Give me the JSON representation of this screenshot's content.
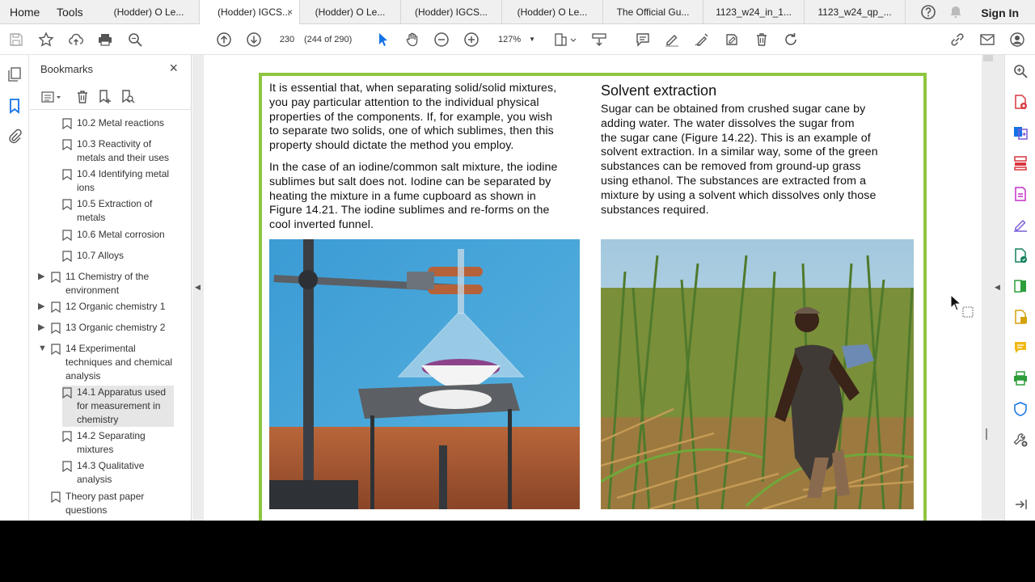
{
  "menu": {
    "home": "Home",
    "tools": "Tools"
  },
  "tabs": [
    {
      "label": "(Hodder) O Le..."
    },
    {
      "label": "(Hodder) IGCS...",
      "close": "×"
    },
    {
      "label": "(Hodder) O Le..."
    },
    {
      "label": "(Hodder) IGCS..."
    },
    {
      "label": "(Hodder) O Le..."
    },
    {
      "label": "The Official Gu..."
    },
    {
      "label": "1123_w24_in_1..."
    },
    {
      "label": "1123_w24_qp_..."
    }
  ],
  "account": {
    "sign_in": "Sign In"
  },
  "toolbar": {
    "page_number": "230",
    "page_count": "(244 of 290)",
    "zoom": "127%"
  },
  "bookmarks": {
    "title": "Bookmarks",
    "close": "×",
    "items": [
      {
        "label": "10.2 Metal reactions"
      },
      {
        "label": "10.3 Reactivity of",
        "label2": "metals and their uses"
      },
      {
        "label": "10.4 Identifying metal",
        "label2": "ions"
      },
      {
        "label": "10.5 Extraction of",
        "label2": "metals"
      },
      {
        "label": "10.6 Metal corrosion"
      },
      {
        "label": "10.7 Alloys"
      },
      {
        "label": "11 Chemistry of the",
        "label2": "environment"
      },
      {
        "label": "12 Organic chemistry 1"
      },
      {
        "label": "13 Organic chemistry 2"
      },
      {
        "label": "14 Experimental",
        "label2": "techniques and chemical",
        "label3": "analysis"
      },
      {
        "label": "14.1 Apparatus used",
        "label2": "for measurement in",
        "label3": "chemistry"
      },
      {
        "label": "14.2 Separating",
        "label2": "mixtures"
      },
      {
        "label": "14.3 Qualitative",
        "label2": "analysis"
      },
      {
        "label": "Theory past paper",
        "label2": "questions"
      }
    ]
  },
  "document": {
    "left_col": {
      "p1": [
        "It is essential that, when separating solid/solid mixtures,",
        "you pay particular attention to the individual physical",
        "properties of the components. If, for example, you wish",
        "to separate two solids, one of which sublimes, then this",
        "property should dictate the method you employ."
      ],
      "p2": [
        "In the case of an iodine/common salt mixture, the iodine",
        "sublimes but salt does not. Iodine can be separated by",
        "heating the mixture in a fume cupboard as shown in",
        "Figure 14.21. The iodine sublimes and re-forms on the",
        "cool inverted funnel."
      ]
    },
    "right_col": {
      "heading": "Solvent extraction",
      "p1": [
        "Sugar can be obtained from crushed sugar cane by",
        "adding water. The water dissolves the sugar from",
        "the sugar cane (Figure 14.22). This is an example of",
        "solvent extraction. In a similar way, some of the green",
        "substances can be removed from ground-up grass",
        "using ethanol. The substances are extracted from a",
        "mixture by using a solvent which dissolves only those",
        "substances required."
      ]
    }
  },
  "colors": {
    "accent_green": "#8dc63f",
    "acrobat_red": "#d7373f",
    "tool_blue": "#1473e6"
  }
}
